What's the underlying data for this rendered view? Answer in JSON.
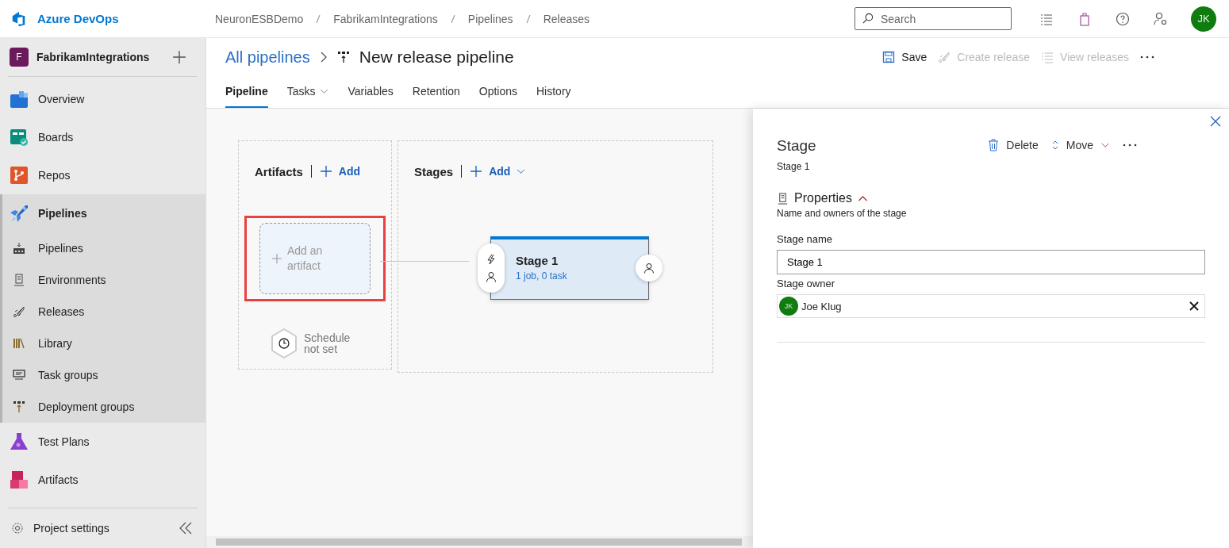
{
  "header": {
    "product": "Azure DevOps",
    "breadcrumbs": [
      "NeuronESBDemo",
      "FabrikamIntegrations",
      "Pipelines",
      "Releases"
    ],
    "search": {
      "placeholder": "Search"
    },
    "avatar": "JK"
  },
  "sidebar": {
    "project": {
      "initial": "F",
      "name": "FabrikamIntegrations"
    },
    "items": [
      {
        "label": "Overview",
        "kind": "overview",
        "selected": false
      },
      {
        "label": "Boards",
        "kind": "boards",
        "selected": false
      },
      {
        "label": "Repos",
        "kind": "repos",
        "selected": false
      },
      {
        "label": "Pipelines",
        "kind": "pipelines",
        "selected": true,
        "expanded": true,
        "children": [
          {
            "label": "Pipelines",
            "kind": "builds"
          },
          {
            "label": "Environments",
            "kind": "environments"
          },
          {
            "label": "Releases",
            "kind": "releases"
          },
          {
            "label": "Library",
            "kind": "library"
          },
          {
            "label": "Task groups",
            "kind": "taskgroups"
          },
          {
            "label": "Deployment groups",
            "kind": "deployment"
          }
        ]
      },
      {
        "label": "Test Plans",
        "kind": "testplans",
        "selected": false
      },
      {
        "label": "Artifacts",
        "kind": "artifacts",
        "selected": false
      }
    ],
    "settings": "Project settings"
  },
  "page": {
    "breadcrumb": "All pipelines",
    "title": "New release pipeline",
    "toolbar": [
      {
        "label": "Save",
        "kind": "save",
        "disabled": false
      },
      {
        "label": "Create release",
        "kind": "rocket",
        "disabled": true
      },
      {
        "label": "View releases",
        "kind": "list",
        "disabled": true
      }
    ],
    "tabs": [
      {
        "label": "Pipeline",
        "selected": true,
        "dropdown": false
      },
      {
        "label": "Tasks",
        "selected": false,
        "dropdown": true
      },
      {
        "label": "Variables",
        "selected": false,
        "dropdown": false
      },
      {
        "label": "Retention",
        "selected": false,
        "dropdown": false
      },
      {
        "label": "Options",
        "selected": false,
        "dropdown": false
      },
      {
        "label": "History",
        "selected": false,
        "dropdown": false
      }
    ]
  },
  "canvas": {
    "artifacts": {
      "title": "Artifacts",
      "add": "Add",
      "placeholder": "Add an artifact",
      "highlighted": true,
      "schedule": "Schedule not set"
    },
    "stages": {
      "title": "Stages",
      "add": "Add",
      "items": [
        {
          "name": "Stage 1",
          "summary": "1 job, 0 task",
          "selected": true
        }
      ]
    }
  },
  "panel": {
    "title": "Stage",
    "subtitle": "Stage 1",
    "actions": [
      {
        "label": "Delete",
        "kind": "delete"
      },
      {
        "label": "Move",
        "kind": "move"
      }
    ],
    "section": {
      "title": "Properties",
      "expanded": true,
      "description": "Name and owners of the stage"
    },
    "fields": [
      {
        "label": "Stage name",
        "kind": "text",
        "value": "Stage 1"
      },
      {
        "label": "Stage owner",
        "kind": "person",
        "initials": "JK",
        "value": "Joe Klug"
      }
    ]
  }
}
